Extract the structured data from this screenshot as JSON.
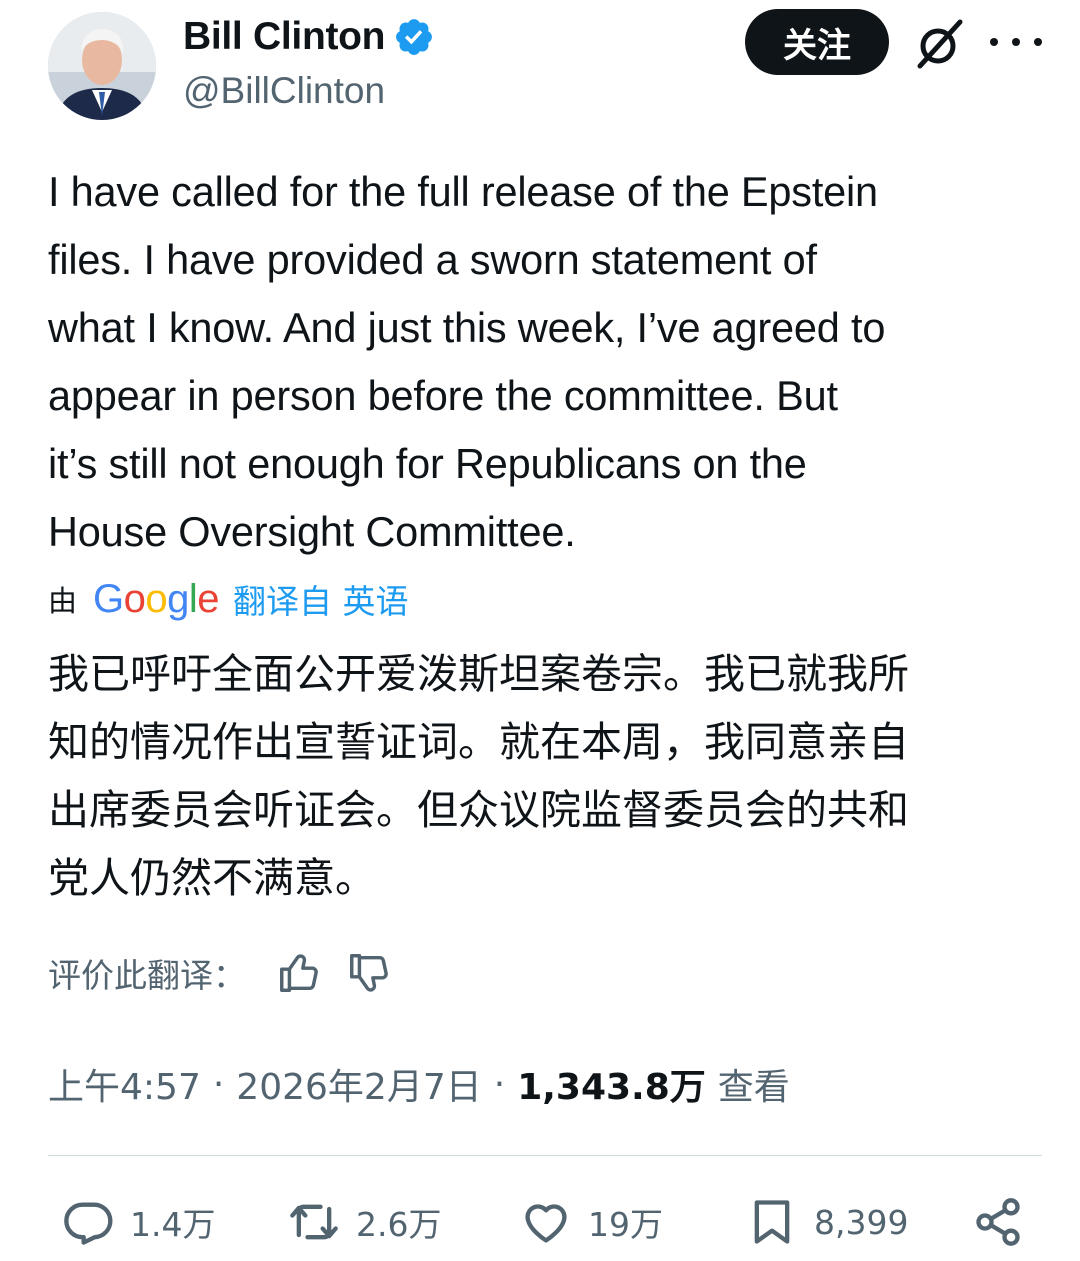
{
  "author": {
    "name": "Bill Clinton",
    "handle": "@BillClinton",
    "follow_label": "关注"
  },
  "tweet": {
    "lines": [
      "I have called for the full release of the Epstein",
      "files. I have provided a sworn statement of",
      "what I know. And just this week, I’ve agreed to",
      "appear in person before the committee. But",
      "it’s still not enough for Republicans on the",
      "House Oversight Committee."
    ]
  },
  "translation": {
    "by": "由",
    "google_letters": [
      "G",
      "o",
      "o",
      "g",
      "l",
      "e"
    ],
    "link": "翻译自 英语",
    "lines": [
      "我已呼吁全面公开爱泼斯坦案卷宗。我已就我所",
      "知的情况作出宣誓证词。就在本周，我同意亲自",
      "出席委员会听证会。但众议院监督委员会的共和",
      "党人仍然不满意。"
    ],
    "rate_label": "评价此翻译："
  },
  "meta": {
    "time": "上午4:57",
    "date": "2026年2月7日",
    "separator": "·",
    "views_count": "1,343.8万",
    "views_label": "查看"
  },
  "actions": {
    "replies": "1.4万",
    "reposts": "2.6万",
    "likes": "19万",
    "bookmarks": "8,399"
  },
  "icons": {
    "verified": "verified-badge-icon",
    "grok": "grok-icon",
    "more": "more-icon",
    "thumb_up": "thumbs-up-icon",
    "thumb_down": "thumbs-down-icon",
    "reply": "reply-icon",
    "repost": "repost-icon",
    "like": "heart-icon",
    "bookmark": "bookmark-icon",
    "share": "share-icon"
  },
  "colors": {
    "text": "#0f1419",
    "secondary": "#536471",
    "link": "#1d9bf0",
    "verified": "#1d9bf0"
  }
}
